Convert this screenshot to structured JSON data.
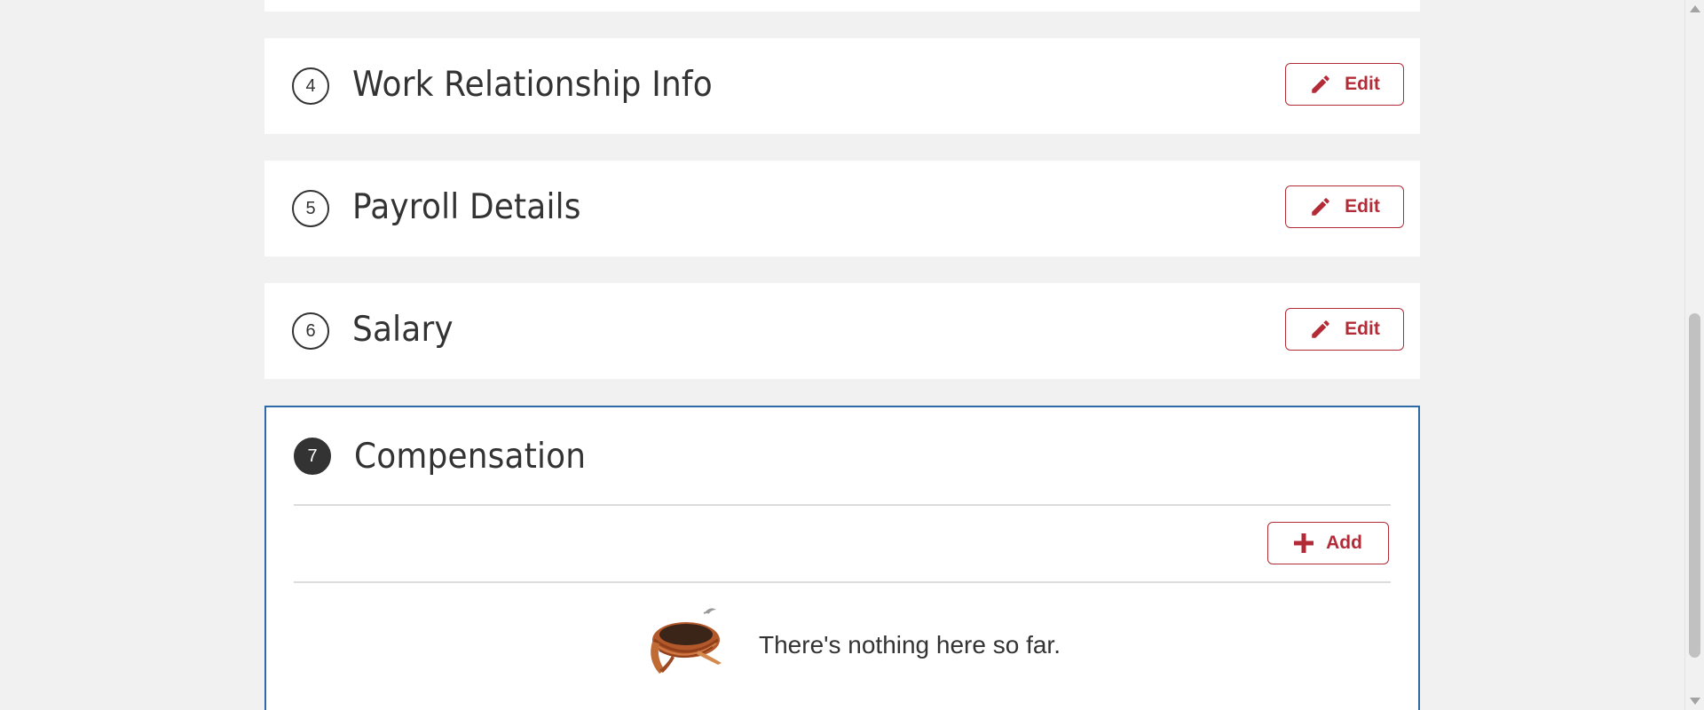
{
  "sections": [
    {
      "number": "4",
      "title": "Work Relationship Info",
      "action_label": "Edit"
    },
    {
      "number": "5",
      "title": "Payroll Details",
      "action_label": "Edit"
    },
    {
      "number": "6",
      "title": "Salary",
      "action_label": "Edit"
    }
  ],
  "active_section": {
    "number": "7",
    "title": "Compensation",
    "add_label": "Add",
    "empty_message": "There's nothing here so far."
  },
  "colors": {
    "accent": "#b22b37",
    "active_border": "#2c6aa8",
    "background": "#f1f1f1"
  },
  "icons": {
    "edit": "pencil-icon",
    "add": "plus-icon",
    "empty": "empty-nest-icon"
  }
}
